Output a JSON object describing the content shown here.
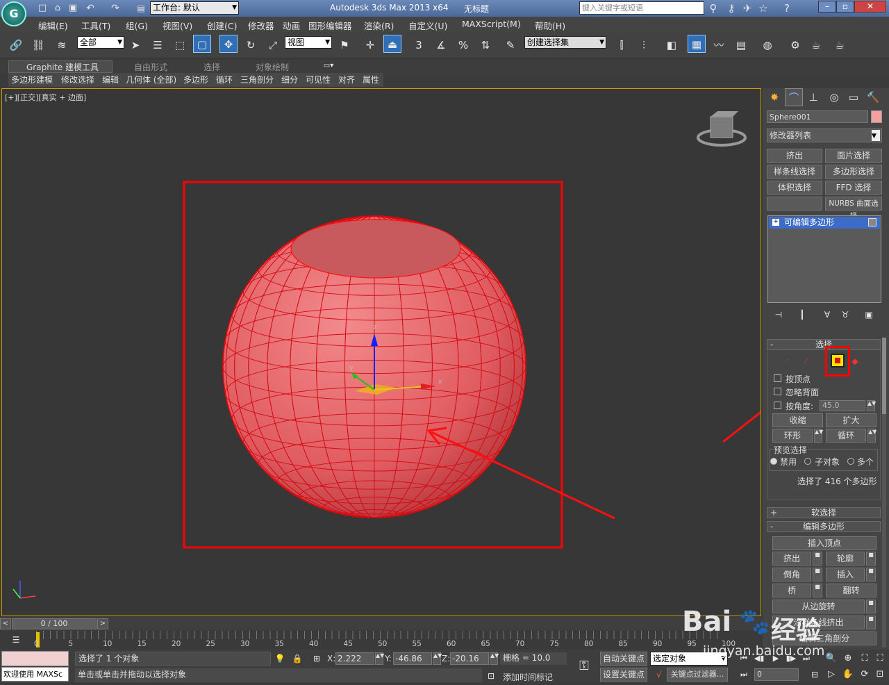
{
  "titlebar": {
    "workspace": "工作台: 默认",
    "app_title": "Autodesk 3ds Max  2013 x64",
    "doc_title": "无标题",
    "search_placeholder": "键入关键字或短语"
  },
  "menu": [
    "编辑(E)",
    "工具(T)",
    "组(G)",
    "视图(V)",
    "创建(C)",
    "修改器",
    "动画",
    "图形编辑器",
    "渲染(R)",
    "自定义(U)",
    "MAXScript(M)",
    "帮助(H)"
  ],
  "toolbar": {
    "selection_filter": "全部",
    "ref_coord": "视图",
    "named_selection": "创建选择集",
    "snap_label": "3",
    "percent_label": "%"
  },
  "graphite": {
    "tabs": [
      "Graphite 建模工具",
      "自由形式",
      "选择",
      "对象绘制"
    ],
    "ribbon": [
      "多边形建模",
      "修改选择",
      "编辑",
      "几何体 (全部)",
      "多边形",
      "循环",
      "三角剖分",
      "细分",
      "可见性",
      "对齐",
      "属性"
    ]
  },
  "viewport": {
    "label": "[+][正交][真实 + 边面]",
    "axis_x": "x",
    "axis_y": "y",
    "axis_z": "z",
    "sphere_color": "#e35f62",
    "highlight_color": "#ff0000"
  },
  "command_panel": {
    "object_name": "Sphere001",
    "object_color": "#f4a0a0",
    "modifier_list": "修改器列表",
    "mod_buttons": [
      "挤出",
      "面片选择",
      "样条线选择",
      "多边形选择",
      "体积选择",
      "FFD 选择",
      "",
      "NURBS 曲面选择"
    ],
    "stack_item": "可编辑多边形",
    "selection": {
      "title": "选择",
      "by_vertex": "按顶点",
      "ignore_backface": "忽略背面",
      "by_angle": "按角度:",
      "angle_value": "45.0",
      "shrink": "收缩",
      "grow": "扩大",
      "ring": "环形",
      "loop": "循环",
      "preview": "预览选择",
      "disable": "禁用",
      "subobject": "子对象",
      "multi": "多个",
      "status": "选择了 416 个多边形"
    },
    "soft_select": "软选择",
    "edit_poly": {
      "title": "编辑多边形",
      "insert_vertex": "插入顶点",
      "extrude": "挤出",
      "outline": "轮廓",
      "bevel": "倒角",
      "inset": "插入",
      "bridge": "桥",
      "flip": "翻转",
      "hinge": "从边旋转",
      "extrude_spline": "沿样条线挤出",
      "edit_tri": "编辑三角剖分"
    }
  },
  "timeline": {
    "frame": "0 / 100",
    "ticks": [
      "0",
      "5",
      "10",
      "15",
      "20",
      "25",
      "30",
      "35",
      "40",
      "45",
      "50",
      "55",
      "60",
      "65",
      "70",
      "75",
      "80",
      "85",
      "90",
      "95",
      "100"
    ]
  },
  "statusbar": {
    "selected": "选择了 1 个对象",
    "prompt": "单击或单击并拖动以选择对象",
    "welcome": "欢迎使用 MAXSc",
    "x": "2.222",
    "y": "-46.86",
    "z": "-20.16",
    "grid": "栅格 = 10.0",
    "auto_key": "自动关键点",
    "set_key": "设置关键点",
    "selected_obj": "选定对象",
    "key_filters": "关键点过滤器...",
    "add_time_tag": "添加时间标记",
    "frame_value": "0"
  },
  "watermark": {
    "brand": "Bai",
    "brand2": "经验",
    "url": "jingyan.baidu.com"
  }
}
